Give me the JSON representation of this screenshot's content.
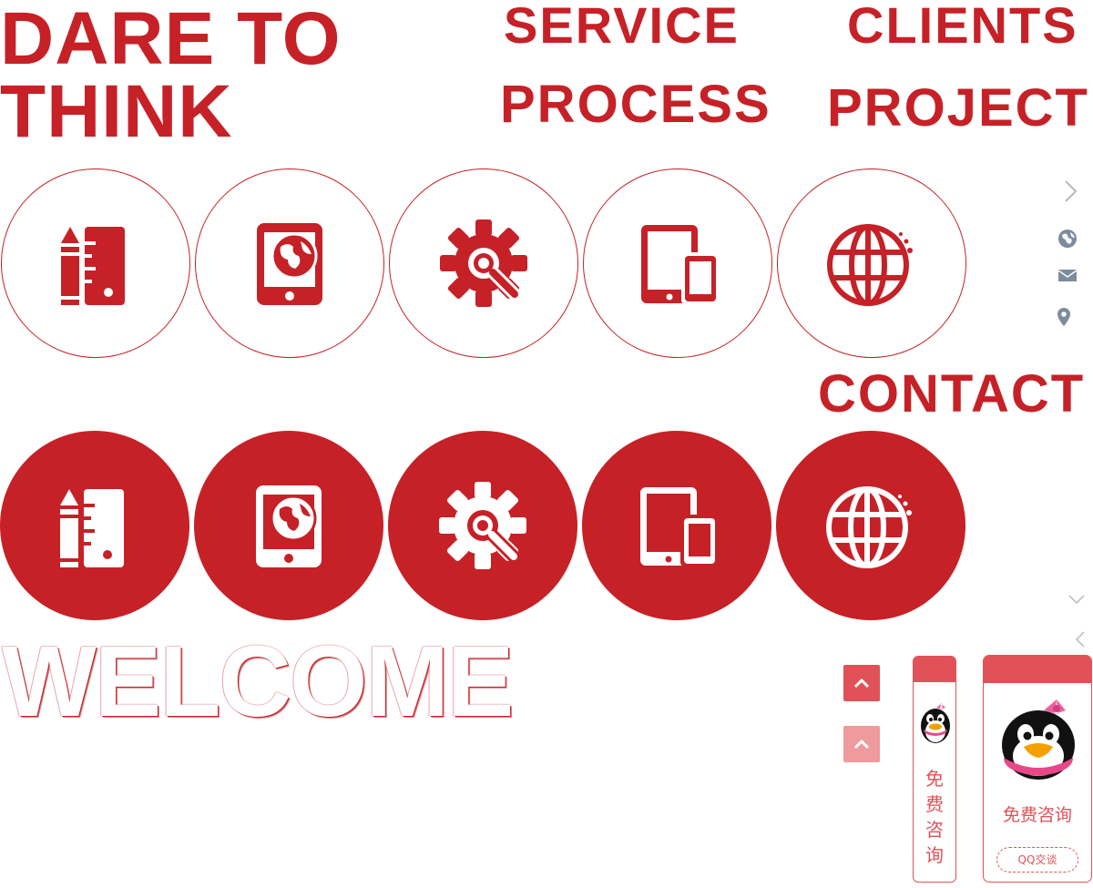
{
  "hero": {
    "line1": "DARE TO",
    "line2": "THINK"
  },
  "nav": {
    "service": "SERVICE",
    "clients": "CLIENTS",
    "process": "PROCESS",
    "project": "PROJECT",
    "contact": "CONTACT"
  },
  "service_icons": [
    "pencil-ruler-icon",
    "phone-globe-icon",
    "gear-wrench-icon",
    "tablet-phone-icon",
    "globe-icon"
  ],
  "side_icons": [
    "chevron-right-icon",
    "globe-icon",
    "mail-icon",
    "location-pin-icon",
    "chevron-down-icon",
    "chevron-left-icon"
  ],
  "welcome": "WELCOME",
  "consult": {
    "narrow_chars": [
      "免",
      "费",
      "咨",
      "询"
    ],
    "label": "免费咨询",
    "qq_button": "QQ交谈"
  },
  "colors": {
    "brand_red": "#c62127",
    "consult_red": "#e05258",
    "top_btn_faded": "#ef9a9d"
  }
}
